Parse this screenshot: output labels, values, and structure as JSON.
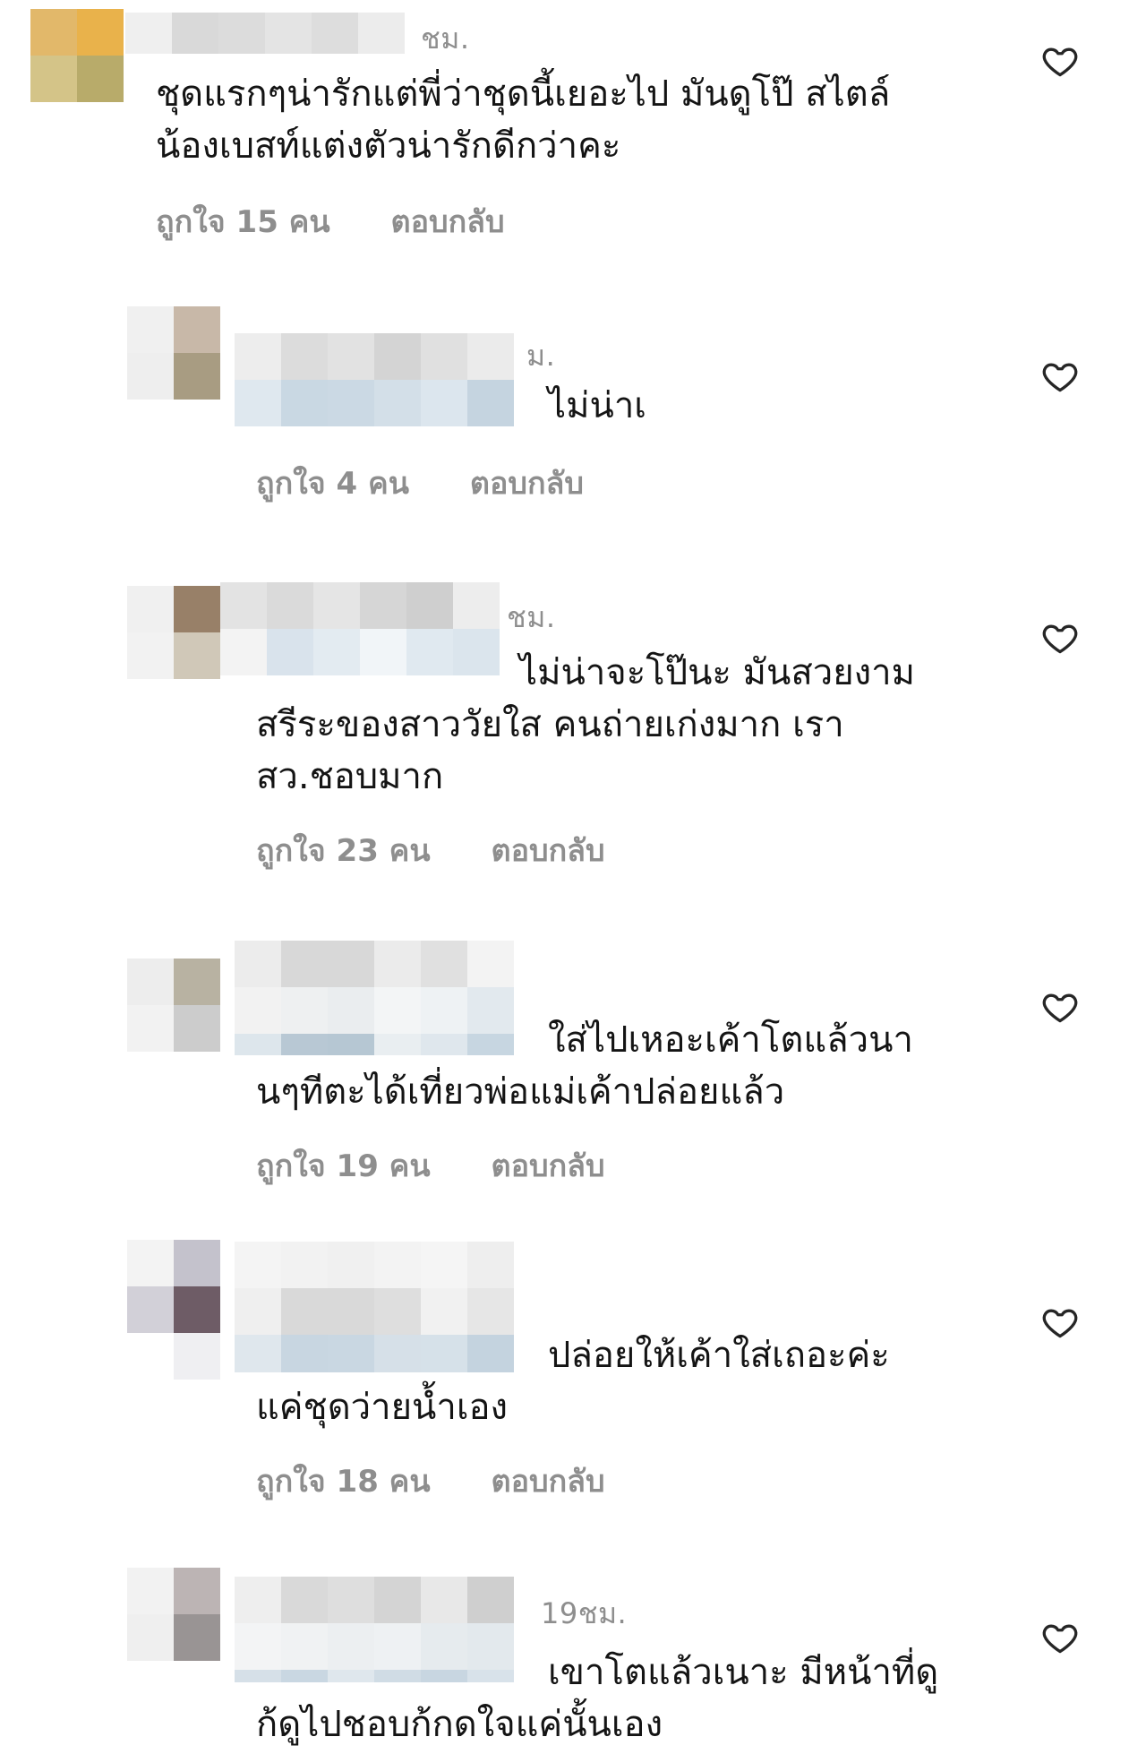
{
  "comments": [
    {
      "time": "ชม.",
      "lines": [
        "ชุดแรกๆน่ารักแต่พี่ว่าชุดนี้เยอะไป มันดูโป๊ สไตล์",
        "น้องเบสท์แต่งตัวน่ารักดีกว่าคะ"
      ],
      "likes": "ถูกใจ 15 คน",
      "reply": "ตอบกลับ"
    },
    {
      "time": "ม.",
      "lines": [
        "ไม่น่าเ"
      ],
      "likes": "ถูกใจ 4 คน",
      "reply": "ตอบกลับ"
    },
    {
      "time": "ชม.",
      "lines": [
        "ไม่น่าจะโป๊นะ มันสวยงาม",
        "สรีระของสาววัยใส คนถ่ายเก่งมาก เรา",
        "สว.ชอบมาก"
      ],
      "likes": "ถูกใจ 23 คน",
      "reply": "ตอบกลับ"
    },
    {
      "time": "",
      "lines": [
        "ใส่ไปเหอะเค้าโตแล้วนา",
        "นๆทีตะได้เที่ยวพ่อแม่เค้าปล่อยแล้ว"
      ],
      "likes": "ถูกใจ 19 คน",
      "reply": "ตอบกลับ"
    },
    {
      "time": "",
      "lines": [
        "ปล่อยให้เค้าใส่เถอะค่ะ",
        "แค่ชุดว่ายน้ำเอง"
      ],
      "likes": "ถูกใจ 18 คน",
      "reply": "ตอบกลับ"
    },
    {
      "time": "19ชม.",
      "lines": [
        "เขาโตแล้วเนาะ มีหน้าที่ดู",
        "ก้ดูไปชอบก้กดใจแค่นั้นเอง"
      ],
      "likes": "",
      "reply": ""
    }
  ],
  "colors": {
    "meta": "#8e8e8e",
    "text": "#141414",
    "heart_stroke": "#262626"
  },
  "icons": {
    "like": "heart-outline-icon"
  }
}
